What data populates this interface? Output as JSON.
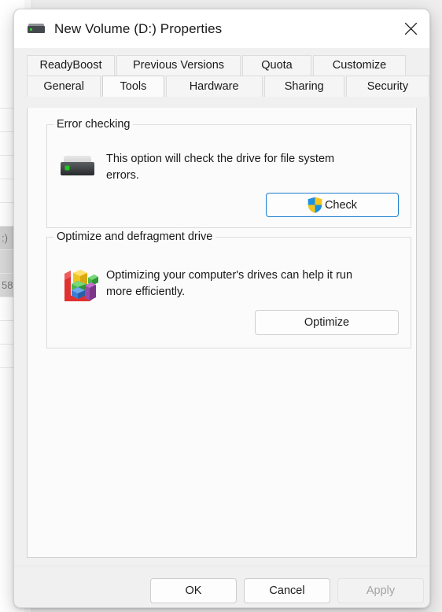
{
  "background": {
    "rows": [
      {
        "text": "",
        "state": "normal"
      },
      {
        "text": "",
        "state": "normal"
      },
      {
        "text": "",
        "state": "normal"
      },
      {
        "text": "",
        "state": "normal"
      },
      {
        "text": "",
        "state": "normal"
      },
      {
        "text": "",
        "state": "normal"
      },
      {
        "text": ":)",
        "state": "selected"
      },
      {
        "text": "",
        "state": "shaded"
      },
      {
        "text": "58",
        "state": "shaded"
      },
      {
        "text": "",
        "state": "normal"
      },
      {
        "text": "",
        "state": "normal"
      },
      {
        "text": "",
        "state": "normal"
      }
    ]
  },
  "dialog": {
    "title": "New Volume (D:) Properties",
    "title_icon": "hard-drive-icon",
    "close_icon": "close-icon",
    "tabs": {
      "top_row": [
        {
          "label": "ReadyBoost",
          "selected": false
        },
        {
          "label": "Previous Versions",
          "selected": false
        },
        {
          "label": "Quota",
          "selected": false
        },
        {
          "label": "Customize",
          "selected": false
        }
      ],
      "bottom_row": [
        {
          "label": "General",
          "selected": false
        },
        {
          "label": "Tools",
          "selected": true
        },
        {
          "label": "Hardware",
          "selected": false
        },
        {
          "label": "Sharing",
          "selected": false
        },
        {
          "label": "Security",
          "selected": false
        }
      ]
    },
    "groups": {
      "error_checking": {
        "legend": "Error checking",
        "icon": "hard-drive-icon",
        "description": "This option will check the drive for file system errors.",
        "button": {
          "label": "Check",
          "icon": "uac-shield-icon",
          "enabled": true,
          "focused": true
        }
      },
      "optimize": {
        "legend": "Optimize and defragment drive",
        "icon": "defragment-blocks-icon",
        "description": "Optimizing your computer's drives can help it run more efficiently.",
        "button": {
          "label": "Optimize",
          "enabled": true,
          "focused": false
        }
      }
    },
    "footer": {
      "ok_label": "OK",
      "cancel_label": "Cancel",
      "apply_label": "Apply",
      "apply_enabled": false
    }
  },
  "colors": {
    "accent_focus_border": "#1d7fd0",
    "shield_blue": "#1e90e0",
    "shield_yellow": "#f5c518",
    "drive_led_green": "#22c322",
    "dialog_background": "#f0f0f0",
    "panel_background": "#fbfbfb",
    "disabled_text": "#a3a3a3"
  }
}
